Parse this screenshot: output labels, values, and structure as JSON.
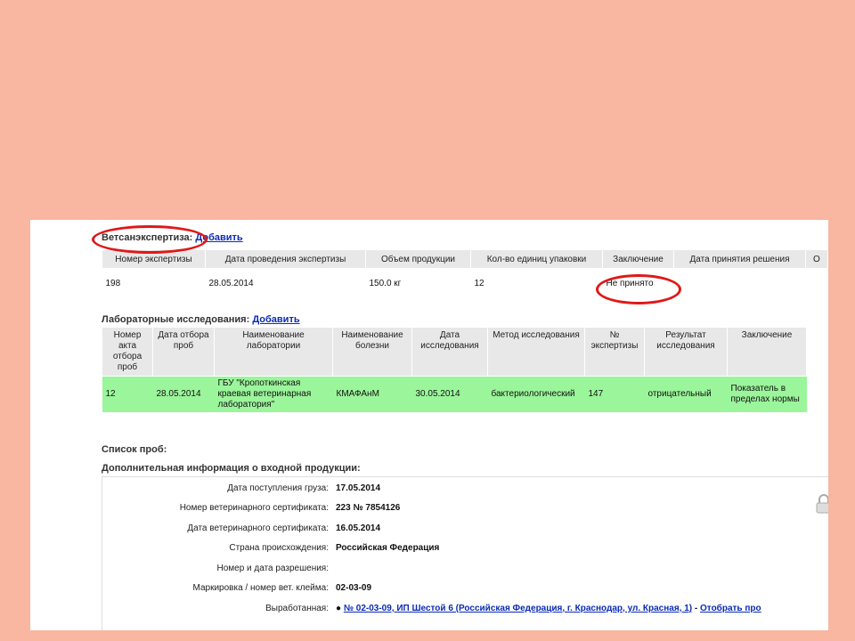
{
  "vet": {
    "title": "Ветсанэкспертиза:",
    "add": "Добавить",
    "headers": [
      "Номер экспертизы",
      "Дата проведения экспертизы",
      "Объем продукции",
      "Кол-во единиц упаковки",
      "Заключение",
      "Дата принятия решения",
      "О"
    ],
    "row": [
      "198",
      "28.05.2014",
      "150.0 кг",
      "12",
      "Не принято",
      ""
    ]
  },
  "lab": {
    "title": "Лабораторные исследования:",
    "add": "Добавить",
    "headers": [
      "Номер акта отбора проб",
      "Дата отбора проб",
      "Наименование лаборатории",
      "Наименование болезни",
      "Дата исследования",
      "Метод исследования",
      "№ экспертизы",
      "Результат исследования",
      "Заключение"
    ],
    "row": [
      "12",
      "28.05.2014",
      "ГБУ \"Кропоткинская краевая ветеринарная лаборатория\"",
      "КМАФАнМ",
      "30.05.2014",
      "бактериологический",
      "147",
      "отрицательный",
      "Показатель в пределах нормы"
    ]
  },
  "samples": {
    "title": "Список проб:"
  },
  "extra": {
    "title": "Дополнительная информация о входной продукции:",
    "rows": [
      {
        "label": "Дата поступления груза:",
        "value": "17.05.2014"
      },
      {
        "label": "Номер ветеринарного сертификата:",
        "value": "223 № 7854126"
      },
      {
        "label": "Дата ветеринарного сертификата:",
        "value": "16.05.2014"
      },
      {
        "label": "Страна происхождения:",
        "value": "Российская Федерация"
      },
      {
        "label": "Номер и дата разрешения:",
        "value": ""
      },
      {
        "label": "Маркировка / номер вет. клейма:",
        "value": "02-03-09"
      },
      {
        "label": "Выработанная:",
        "value": ""
      }
    ],
    "produced_link": "№ 02-03-09, ИП Шестой 6 (Российская Федерация, г. Краснодар, ул. Красная, 1)",
    "produced_sep": " - ",
    "produced_link2": "Отобрать про"
  }
}
